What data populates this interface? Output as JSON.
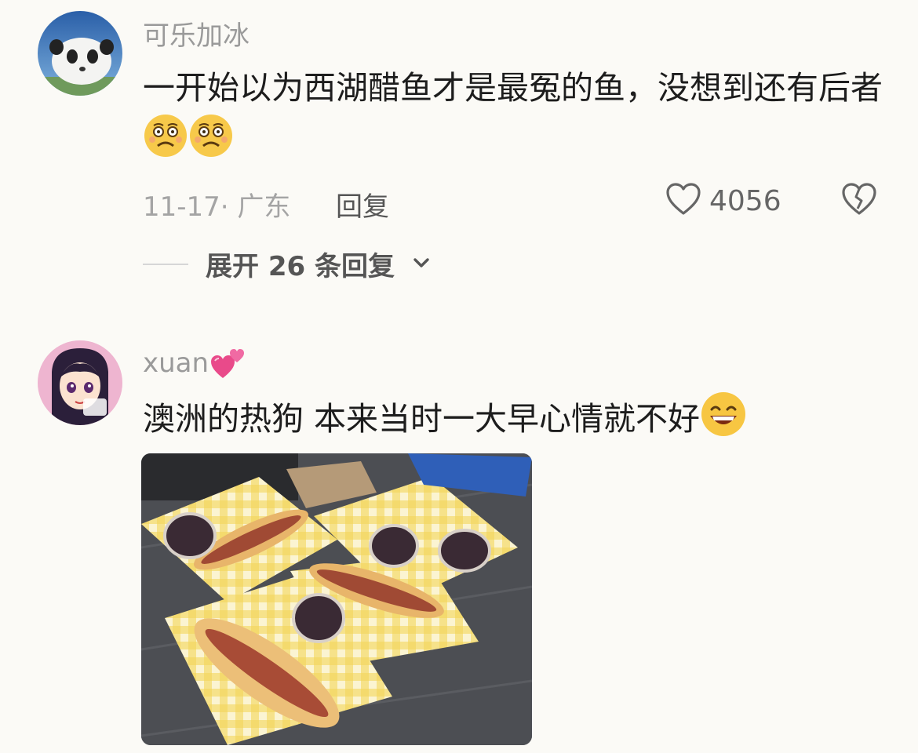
{
  "comments": [
    {
      "username": "可乐加冰",
      "text": "一开始以为西湖醋鱼才是最冤的鱼，没想到还有后者",
      "emojis": [
        "woozy-face-emoji",
        "woozy-face-emoji"
      ],
      "meta": "11-17· 广东",
      "reply_label": "回复",
      "like_count": "4056",
      "expand_label": "展开 26 条回复"
    },
    {
      "username": "xuan",
      "username_emoji": "two-hearts-emoji",
      "text": "澳洲的热狗 本来当时一大早心情就不好",
      "emoji": "grinning-face-emoji",
      "image": "hot-dogs-photo"
    }
  ],
  "colors": {
    "background": "#fbfaf6",
    "muted_text": "#9a9a9a",
    "body_text": "#1d1d1d"
  }
}
